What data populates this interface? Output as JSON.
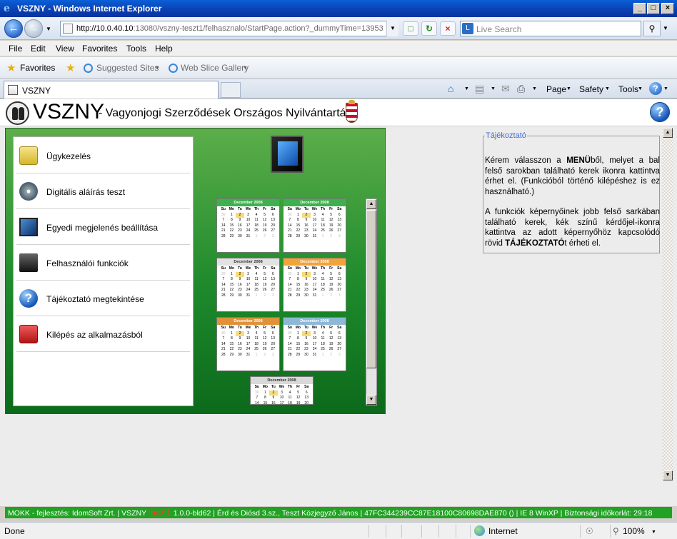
{
  "window": {
    "title": "VSZNY - Windows Internet Explorer",
    "minimize": "_",
    "maximize": "□",
    "close": "×"
  },
  "address": {
    "host": "http://10.0.40.10",
    "rest": ":13080/vszny-teszt1/felhasznalo/StartPage.action?_dummyTime=13953",
    "search_placeholder": "Live Search"
  },
  "menu": [
    "File",
    "Edit",
    "View",
    "Favorites",
    "Tools",
    "Help"
  ],
  "favorites": {
    "favorites_label": "Favorites",
    "suggested": "Suggested Sites",
    "slice": "Web Slice Gallery"
  },
  "tab": {
    "label": "VSZNY"
  },
  "commands": {
    "page": "Page",
    "safety": "Safety",
    "tools": "Tools"
  },
  "app": {
    "name": "VSZNY",
    "subtitle": "- Vagyonjogi Szerződések Országos Nyilvántartása",
    "menu_items": [
      "Ügykezelés",
      "Digitális aláírás teszt",
      "Egyedi megjelenés beállítása",
      "Felhasználói funkciók",
      "Tájékoztató megtekintése",
      "Kilépés az alkalmazásból"
    ],
    "calendar": {
      "month": "December 2008",
      "days": [
        "Su",
        "Mo",
        "Tu",
        "We",
        "Th",
        "Fr",
        "Sa"
      ],
      "header_colors": [
        "#3fb04f",
        "#3fb04f",
        "#e2e2e2",
        "#f2a33a",
        "#e0913a",
        "#8fb8d8",
        "#d9d9d9"
      ]
    }
  },
  "info": {
    "legend": "Tájékoztató",
    "p1_pre": "Kérem válasszon a ",
    "p1_bold": "MENÜ",
    "p1_post": "ből, melyet a bal felső sarokban található kerek ikonra kattintva érhet el. (Funkcióból történő kilépéshez is ez használható.)",
    "p2_pre": "A funkciók képernyőinek jobb felső sarkában található kerek, kék színű kérdőjel-ikonra kattintva az adott képernyőhöz kapcsolódó rövid ",
    "p2_bold": "TÁJÉKOZTATÓ",
    "p2_post": "t érheti el."
  },
  "app_status": {
    "part1": "MOKK - fejlesztés: IdomSoft Zrt.  | VSZNY ",
    "env": "teszt1",
    "part2": " 1.0.0-bld62  | Érd és Diósd 3.sz., Teszt Közjegyző János  | 47FC344239CC87E18100C80698DAE870 ()  | IE 8 WinXP  | Biztonsági időkorlát:  29:18"
  },
  "statusbar": {
    "done": "Done",
    "zone": "Internet",
    "zoom": "100%"
  }
}
